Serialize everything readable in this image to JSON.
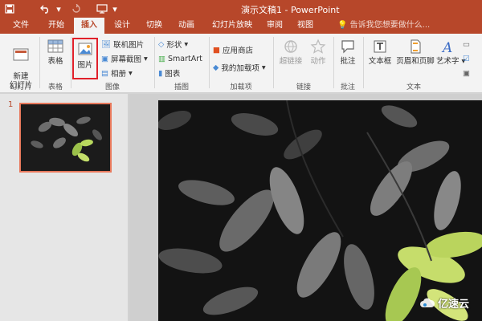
{
  "title": "演示文稿1 - PowerPoint",
  "tabs": [
    "文件",
    "开始",
    "插入",
    "设计",
    "切换",
    "动画",
    "幻灯片放映",
    "审阅",
    "视图"
  ],
  "active_tab": "插入",
  "tell_me": "告诉我您想要做什么...",
  "ribbon": {
    "new_slide": "新建\n幻灯片",
    "table": "表格",
    "picture": "图片",
    "online_picture": "联机图片",
    "screenshot": "屏幕截图",
    "album": "相册",
    "shapes": "形状",
    "smartart": "SmartArt",
    "chart": "图表",
    "store": "应用商店",
    "my_addins": "我的加载项",
    "hyperlink": "超链接",
    "action": "动作",
    "comment": "批注",
    "textbox": "文本框",
    "header_footer": "页眉和页脚",
    "wordart": "艺术字"
  },
  "groups": {
    "slides": "幻灯片",
    "tables": "表格",
    "images": "图像",
    "illustrations": "插图",
    "addins": "加载项",
    "links": "链接",
    "comments": "批注",
    "text": "文本"
  },
  "slide_number": "1",
  "watermark": "亿速云",
  "colors": {
    "accent": "#b7472a",
    "highlight": "#e0202a"
  }
}
